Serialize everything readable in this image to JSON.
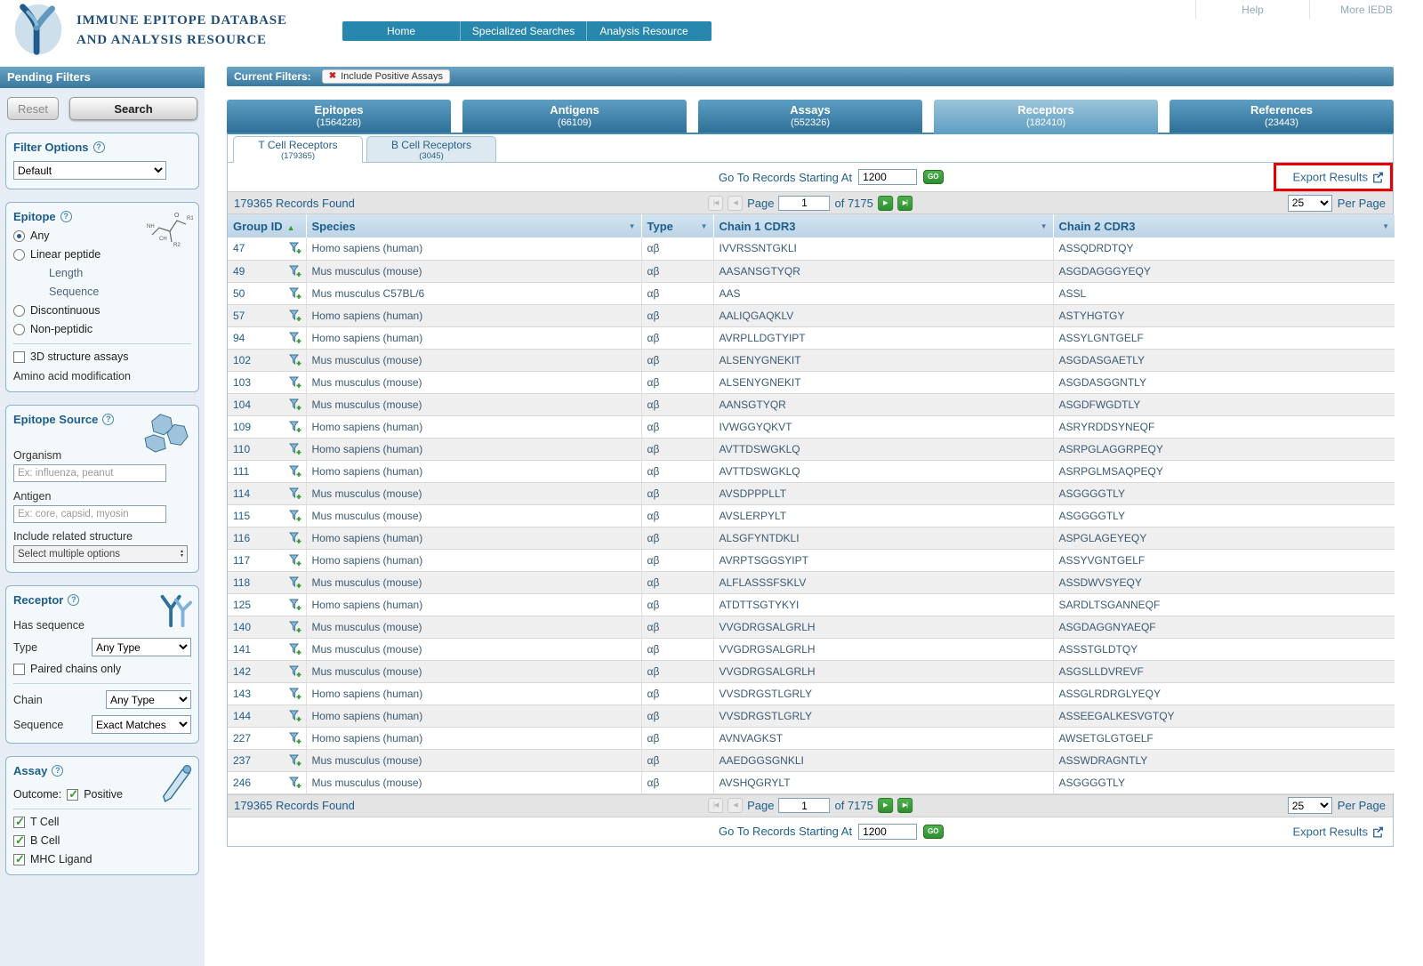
{
  "colors": {
    "brand_teal": "#2787ac",
    "bar_gradient_top": "#6aa3c4",
    "bar_gradient_bottom": "#39789f",
    "link_blue": "#1d5d8c",
    "export_blue": "#2a6496",
    "action_green": "#2e9e2e",
    "annotation_red": "#e80000"
  },
  "icons": {
    "help_glyph": "?",
    "remove_x": "✖",
    "sort_asc": "▲",
    "column_menu": "▼",
    "first_page": "|◀",
    "prev_page": "◀",
    "next_page": "▶",
    "last_page": "▶|",
    "updown_up": "▴",
    "updown_down": "▾"
  },
  "header": {
    "title_line1": "IMMUNE EPITOPE DATABASE",
    "title_line2": "AND ANALYSIS RESOURCE",
    "links": [
      {
        "label": "Help"
      },
      {
        "label": "More IEDB"
      }
    ],
    "nav": [
      {
        "label": "Home"
      },
      {
        "label": "Specialized Searches"
      },
      {
        "label": "Analysis Resource"
      }
    ]
  },
  "sidebar": {
    "title": "Pending Filters",
    "reset_label": "Reset",
    "search_label": "Search",
    "filter_options": {
      "title": "Filter Options",
      "selected": "Default"
    },
    "epitope": {
      "title": "Epitope",
      "any": "Any",
      "linear": "Linear peptide",
      "length": "Length",
      "sequence": "Sequence",
      "discontinuous": "Discontinuous",
      "non_peptidic": "Non-peptidic",
      "structure_assays": "3D structure assays",
      "amino_modification": "Amino acid modification"
    },
    "epitope_source": {
      "title": "Epitope Source",
      "organism_label": "Organism",
      "organism_placeholder": "Ex: influenza, peanut",
      "antigen_label": "Antigen",
      "antigen_placeholder": "Ex: core, capsid, myosin",
      "related_label": "Include related structure",
      "related_value": "Select multiple options"
    },
    "receptor": {
      "title": "Receptor",
      "has_sequence": "Has sequence",
      "type_label": "Type",
      "type_value": "Any Type",
      "paired_label": "Paired chains only",
      "chain_label": "Chain",
      "chain_value": "Any Type",
      "sequence_label": "Sequence",
      "sequence_value": "Exact Matches"
    },
    "assay": {
      "title": "Assay",
      "outcome_label": "Outcome:",
      "positive_label": "Positive",
      "t_cell": "T Cell",
      "b_cell": "B Cell",
      "mhc_ligand": "MHC Ligand"
    }
  },
  "main": {
    "current_filters": {
      "label": "Current Filters:",
      "chip_label": "Include Positive Assays"
    },
    "tabs": [
      {
        "label": "Epitopes",
        "count": "(1564228)"
      },
      {
        "label": "Antigens",
        "count": "(66109)"
      },
      {
        "label": "Assays",
        "count": "(552326)"
      },
      {
        "label": "Receptors",
        "count": "(182410)"
      },
      {
        "label": "References",
        "count": "(23443)"
      }
    ],
    "subtabs": [
      {
        "label": "T Cell Receptors",
        "count": "(179365)"
      },
      {
        "label": "B Cell Receptors",
        "count": "(3045)"
      }
    ],
    "goto": {
      "label": "Go To Records Starting At",
      "value": "1200",
      "go_label": "GO"
    },
    "export_label": "Export Results",
    "records_found": "179365 Records Found",
    "pagination": {
      "page_label": "Page",
      "page_value": "1",
      "of_label": "of 7175"
    },
    "per_page": {
      "value": "25",
      "label": "Per Page"
    },
    "table": {
      "columns": [
        "Group ID",
        "Species",
        "Type",
        "Chain 1 CDR3",
        "Chain 2 CDR3"
      ],
      "rows": [
        {
          "id": "47",
          "species": "Homo sapiens (human)",
          "type": "αβ",
          "cdr1": "IVVRSSNTGKLI",
          "cdr2": "ASSQDRDTQY"
        },
        {
          "id": "49",
          "species": "Mus musculus (mouse)",
          "type": "αβ",
          "cdr1": "AASANSGTYQR",
          "cdr2": "ASGDAGGGYEQY"
        },
        {
          "id": "50",
          "species": "Mus musculus C57BL/6",
          "type": "αβ",
          "cdr1": "AAS",
          "cdr2": "ASSL"
        },
        {
          "id": "57",
          "species": "Homo sapiens (human)",
          "type": "αβ",
          "cdr1": "AALIQGAQKLV",
          "cdr2": "ASTYHGTGY"
        },
        {
          "id": "94",
          "species": "Homo sapiens (human)",
          "type": "αβ",
          "cdr1": "AVRPLLDGTYIPT",
          "cdr2": "ASSYLGNTGELF"
        },
        {
          "id": "102",
          "species": "Mus musculus (mouse)",
          "type": "αβ",
          "cdr1": "ALSENYGNEKIT",
          "cdr2": "ASGDASGAETLY"
        },
        {
          "id": "103",
          "species": "Mus musculus (mouse)",
          "type": "αβ",
          "cdr1": "ALSENYGNEKIT",
          "cdr2": "ASGDASGGNTLY"
        },
        {
          "id": "104",
          "species": "Mus musculus (mouse)",
          "type": "αβ",
          "cdr1": "AANSGTYQR",
          "cdr2": "ASGDFWGDTLY"
        },
        {
          "id": "109",
          "species": "Homo sapiens (human)",
          "type": "αβ",
          "cdr1": "IVWGGYQKVT",
          "cdr2": "ASRYRDDSYNEQF"
        },
        {
          "id": "110",
          "species": "Homo sapiens (human)",
          "type": "αβ",
          "cdr1": "AVTTDSWGKLQ",
          "cdr2": "ASRPGLAGGRPEQY"
        },
        {
          "id": "111",
          "species": "Homo sapiens (human)",
          "type": "αβ",
          "cdr1": "AVTTDSWGKLQ",
          "cdr2": "ASRPGLMSAQPEQY"
        },
        {
          "id": "114",
          "species": "Mus musculus (mouse)",
          "type": "αβ",
          "cdr1": "AVSDPPPLLT",
          "cdr2": "ASGGGGTLY"
        },
        {
          "id": "115",
          "species": "Mus musculus (mouse)",
          "type": "αβ",
          "cdr1": "AVSLERPYLT",
          "cdr2": "ASGGGGTLY"
        },
        {
          "id": "116",
          "species": "Homo sapiens (human)",
          "type": "αβ",
          "cdr1": "ALSGFYNTDKLI",
          "cdr2": "ASPGLAGEYEQY"
        },
        {
          "id": "117",
          "species": "Homo sapiens (human)",
          "type": "αβ",
          "cdr1": "AVRPTSGGSYIPT",
          "cdr2": "ASSYVGNTGELF"
        },
        {
          "id": "118",
          "species": "Mus musculus (mouse)",
          "type": "αβ",
          "cdr1": "ALFLASSSFSKLV",
          "cdr2": "ASSDWVSYEQY"
        },
        {
          "id": "125",
          "species": "Homo sapiens (human)",
          "type": "αβ",
          "cdr1": "ATDTTSGTYKYI",
          "cdr2": "SARDLTSGANNEQF"
        },
        {
          "id": "140",
          "species": "Mus musculus (mouse)",
          "type": "αβ",
          "cdr1": "VVGDRGSALGRLH",
          "cdr2": "ASGDAGGNYAEQF"
        },
        {
          "id": "141",
          "species": "Mus musculus (mouse)",
          "type": "αβ",
          "cdr1": "VVGDRGSALGRLH",
          "cdr2": "ASSSTGLDTQY"
        },
        {
          "id": "142",
          "species": "Mus musculus (mouse)",
          "type": "αβ",
          "cdr1": "VVGDRGSALGRLH",
          "cdr2": "ASGSLLDVREVF"
        },
        {
          "id": "143",
          "species": "Homo sapiens (human)",
          "type": "αβ",
          "cdr1": "VVSDRGSTLGRLY",
          "cdr2": "ASSGLRDRGLYEQY"
        },
        {
          "id": "144",
          "species": "Homo sapiens (human)",
          "type": "αβ",
          "cdr1": "VVSDRGSTLGRLY",
          "cdr2": "ASSEEGALKESVGTQY"
        },
        {
          "id": "227",
          "species": "Homo sapiens (human)",
          "type": "αβ",
          "cdr1": "AVNVAGKST",
          "cdr2": "AWSETGLGTGELF"
        },
        {
          "id": "237",
          "species": "Mus musculus (mouse)",
          "type": "αβ",
          "cdr1": "AAEDGGSGNKLI",
          "cdr2": "ASSWDRAGNTLY"
        },
        {
          "id": "246",
          "species": "Mus musculus (mouse)",
          "type": "αβ",
          "cdr1": "AVSHQGRYLT",
          "cdr2": "ASGGGGTLY"
        }
      ]
    }
  }
}
